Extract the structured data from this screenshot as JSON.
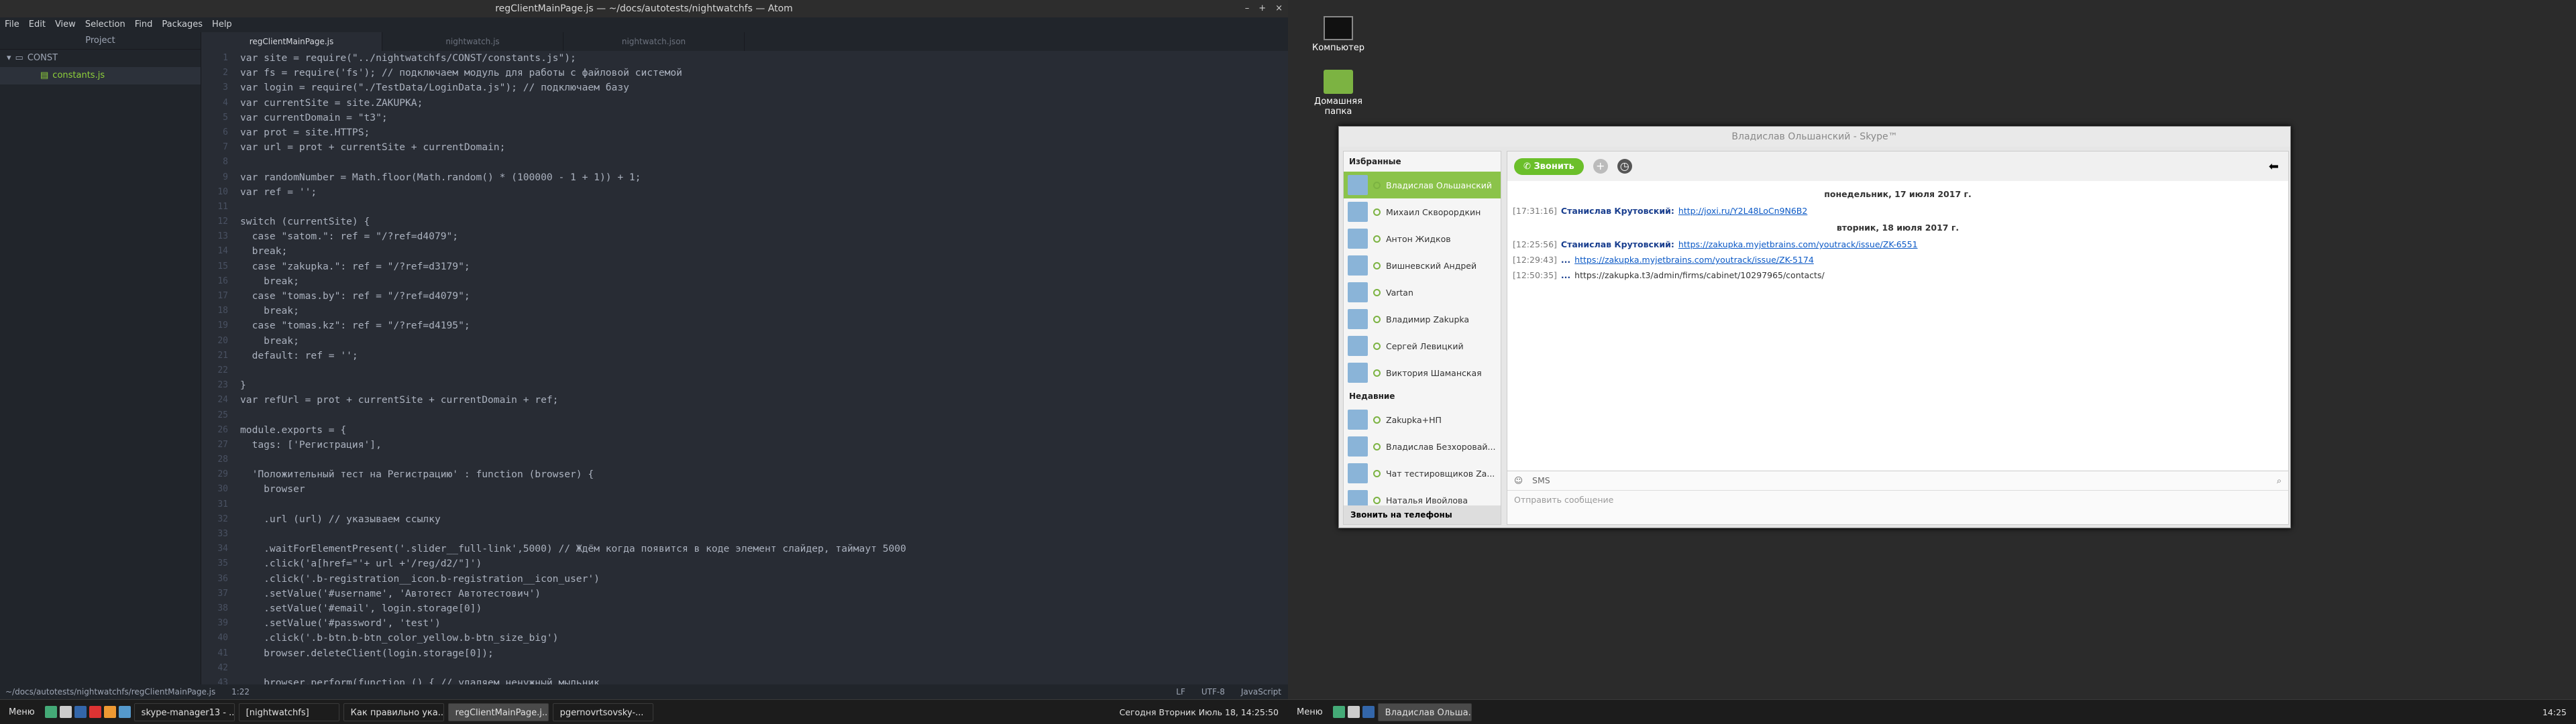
{
  "atom": {
    "title": "regClientMainPage.js — ~/docs/autotests/nightwatchfs — Atom",
    "window_controls": [
      "–",
      "+",
      "×"
    ],
    "menu": [
      "File",
      "Edit",
      "View",
      "Selection",
      "Find",
      "Packages",
      "Help"
    ],
    "project_header": "Project",
    "tree": {
      "folder": "CONST",
      "file": "constants.js"
    },
    "tabs": [
      "regClientMainPage.js",
      "nightwatch.js",
      "nightwatch.json"
    ],
    "lines": [
      "var site = require(\"../nightwatchfs/CONST/constants.js\");",
      "var fs = require('fs'); // подключаем модуль для работы с файловой системой",
      "var login = require(\"./TestData/LoginData.js\"); // подключаем базу",
      "var currentSite = site.ZAKUPKA;",
      "var currentDomain = \"t3\";",
      "var prot = site.HTTPS;",
      "var url = prot + currentSite + currentDomain;",
      "",
      "var randomNumber = Math.floor(Math.random() * (100000 - 1 + 1)) + 1;",
      "var ref = '';",
      "",
      "switch (currentSite) {",
      "  case \"satom.\": ref = \"/?ref=d4079\";",
      "  break;",
      "  case \"zakupka.\": ref = \"/?ref=d3179\";",
      "    break;",
      "  case \"tomas.by\": ref = \"/?ref=d4079\";",
      "    break;",
      "  case \"tomas.kz\": ref = \"/?ref=d4195\";",
      "    break;",
      "  default: ref = '';",
      "",
      "}",
      "var refUrl = prot + currentSite + currentDomain + ref;",
      "",
      "module.exports = {",
      "  tags: ['Регистрация'],",
      "",
      "  'Положительный тест на Регистрацию' : function (browser) {",
      "    browser",
      "",
      "    .url (url) // указываем ссылку",
      "",
      "    .waitForElementPresent('.slider__full-link',5000) // Ждём когда появится в коде элемент слайдер, таймаут 5000",
      "    .click('a[href=\"'+ url +'/reg/d2/\"]')",
      "    .click('.b-registration__icon.b-registration__icon_user')",
      "    .setValue('#username', 'Автотест Автотестович')",
      "    .setValue('#email', login.storage[0])",
      "    .setValue('#password', 'test')",
      "    .click('.b-btn.b-btn_color_yellow.b-btn_size_big')",
      "    browser.deleteClient(login.storage[0]);",
      "",
      "    browser.perform(function () { // удаляем ненужный мыльник"
    ],
    "status": {
      "path": "~/docs/autotests/nightwatchfs/regClientMainPage.js",
      "pos": "1:22",
      "eol": "LF",
      "enc": "UTF-8",
      "grammar": "JavaScript"
    }
  },
  "taskbar_left": {
    "menu": "Меню",
    "tasks": [
      "skype-manager13 - ...",
      "[nightwatchfs]",
      "Как правильно ука...",
      "regClientMainPage.j...",
      "pgernovrtsovsky-...",
      ""
    ],
    "clock": "Сегодня Вторник Июль 18, 14:25:50"
  },
  "desktop": {
    "computer": "Компьютер",
    "home": "Домашняя папка"
  },
  "skype": {
    "title": "Владислав Ольшанский - Skype™",
    "favorites_header": "Избранные",
    "favorites": [
      "Владислав Ольшанский",
      "Михаил Скворордкин",
      "Антон Жидков",
      "Вишневский Андрей",
      "Vartan",
      "Владимир Zakupka",
      "Сергей Левицкий",
      "Виктория Шаманская"
    ],
    "recent_header": "Недавние",
    "recent": [
      "Zakupka+НП",
      "Владислав Безхоровай...",
      "Чат тестировщиков Za...",
      "Наталья Ивойлова"
    ],
    "call_phones": "Звонить на телефоны",
    "call_button": "Звонить",
    "messages": [
      {
        "type": "date",
        "text": "понедельник, 17 июля 2017 г."
      },
      {
        "time": "[17:31:16]",
        "author": "Станислав Крутовский:",
        "link": "http://joxi.ru/Y2L48LoCn9N6B2",
        "plain": ""
      },
      {
        "type": "date",
        "text": "вторник, 18 июля 2017 г."
      },
      {
        "time": "[12:25:56]",
        "author": "Станислав Крутовский:",
        "link": "https://zakupka.myjetbrains.com/youtrack/issue/ZK-6551",
        "plain": ""
      },
      {
        "time": "[12:29:43]",
        "author": "...",
        "link": "https://zakupka.myjetbrains.com/youtrack/issue/ZK-5174",
        "plain": ""
      },
      {
        "time": "[12:50:35]",
        "author": "...",
        "link": "",
        "plain": "https://zakupka.t3/admin/firms/cabinet/10297965/contacts/"
      }
    ],
    "compose_sms": "SMS",
    "compose_placeholder": "Отправить сообщение"
  },
  "taskbar_right": {
    "menu": "Меню",
    "task": "Владислав Ольша...",
    "clock": "14:25"
  }
}
